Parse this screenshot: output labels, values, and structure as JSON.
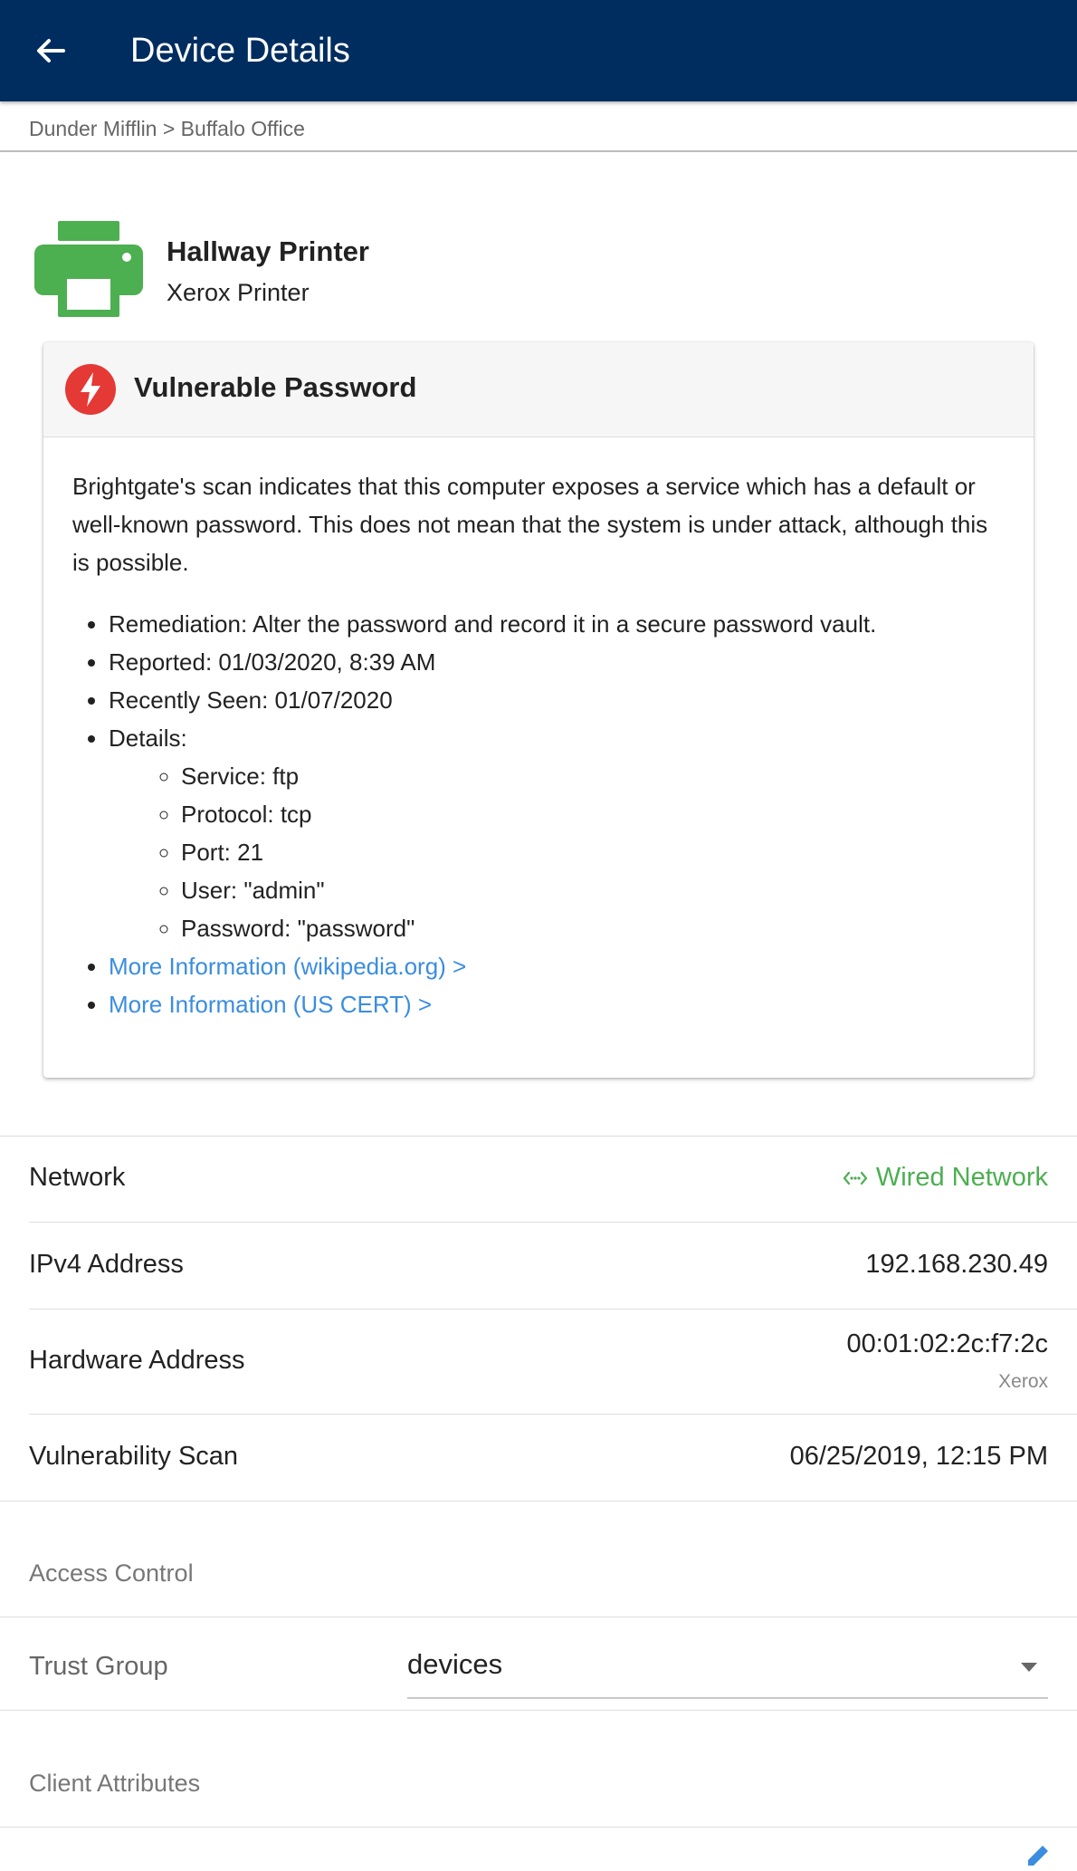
{
  "appbar": {
    "title": "Device Details"
  },
  "breadcrumb": "Dunder Mifflin > Buffalo Office",
  "device": {
    "name": "Hallway Printer",
    "type": "Xerox Printer",
    "icon": "printer-icon",
    "icon_color": "#4caf50"
  },
  "alert": {
    "title": "Vulnerable Password",
    "icon": "alert-bolt-icon",
    "icon_color": "#e53935",
    "description": "Brightgate's scan indicates that this computer exposes a service which has a default or well-known password. This does not mean that the system is under attack, although this is possible.",
    "items": [
      "Remediation: Alter the password and record it in a secure password vault.",
      "Reported: 01/03/2020, 8:39 AM",
      "Recently Seen: 01/07/2020",
      "Details:"
    ],
    "details": [
      "Service: ftp",
      "Protocol: tcp",
      "Port: 21",
      "User: \"admin\"",
      "Password: \"password\""
    ],
    "links": [
      "More Information (wikipedia.org) >",
      "More Information (US CERT) >"
    ],
    "link_color": "#3a8de0"
  },
  "info": {
    "network_label": "Network",
    "network_value": "Wired Network",
    "network_color": "#4caf50",
    "ipv4_label": "IPv4 Address",
    "ipv4_value": "192.168.230.49",
    "hw_label": "Hardware Address",
    "hw_value": "00:01:02:2c:f7:2c",
    "hw_vendor": "Xerox",
    "scan_label": "Vulnerability Scan",
    "scan_value": "06/25/2019, 12:15 PM"
  },
  "access_control": {
    "heading": "Access Control",
    "trust_label": "Trust Group",
    "trust_value": "devices"
  },
  "client_attributes": {
    "heading": "Client Attributes"
  },
  "colors": {
    "appbar": "#002d5f"
  }
}
